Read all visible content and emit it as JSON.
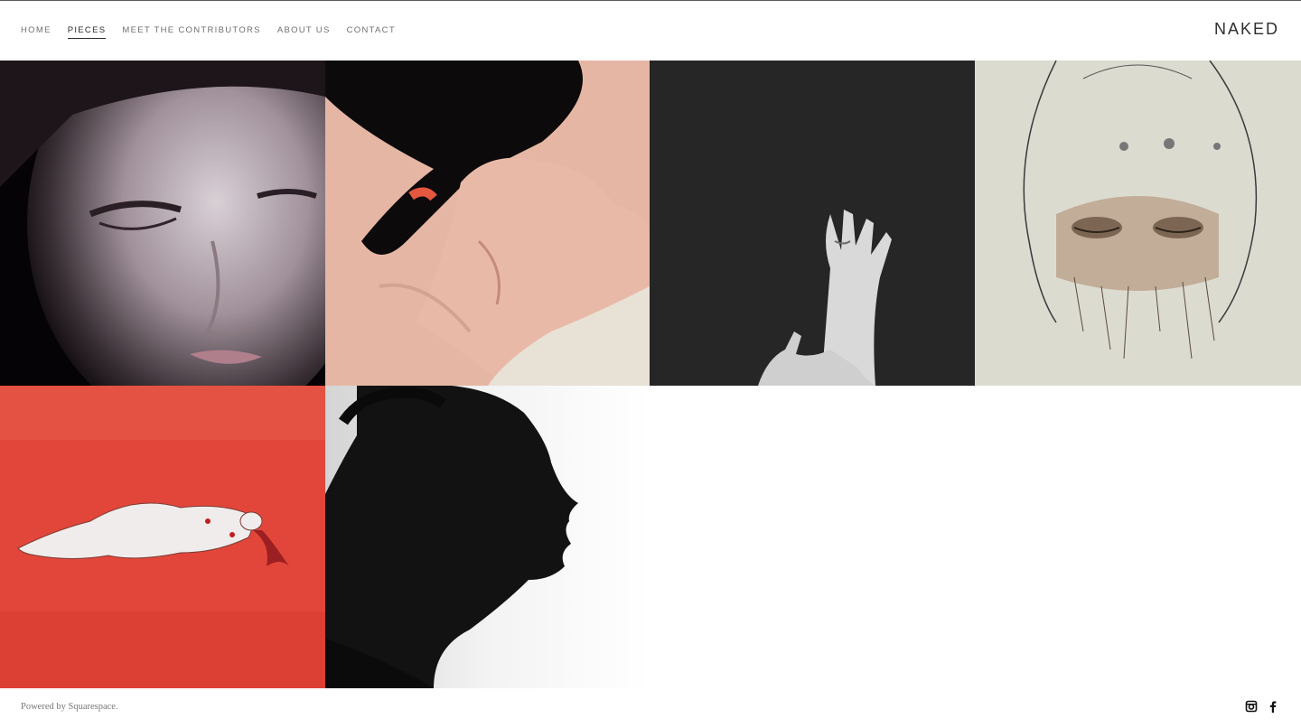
{
  "header": {
    "nav": [
      {
        "label": "HOME",
        "active": false
      },
      {
        "label": "PIECES",
        "active": true
      },
      {
        "label": "MEET THE CONTRIBUTORS",
        "active": false
      },
      {
        "label": "ABOUT US",
        "active": false
      },
      {
        "label": "CONTACT",
        "active": false
      }
    ],
    "logo": "NAKED"
  },
  "gallery": {
    "items": [
      {
        "subject": "woman-face-eyes-closed"
      },
      {
        "subject": "painted-embrace"
      },
      {
        "subject": "hands-on-dark"
      },
      {
        "subject": "drawn-face-sketch"
      },
      {
        "subject": "red-reclining-figure"
      },
      {
        "subject": "profile-silhouette"
      }
    ]
  },
  "footer": {
    "powered_by": "Powered by Squarespace.",
    "social": [
      "instagram-icon",
      "facebook-icon"
    ]
  },
  "colors": {
    "nav_text": "#6f6f6f",
    "nav_active": "#2b2b2b",
    "logo": "#2f2f2f",
    "red_painting": "#e2463a"
  }
}
